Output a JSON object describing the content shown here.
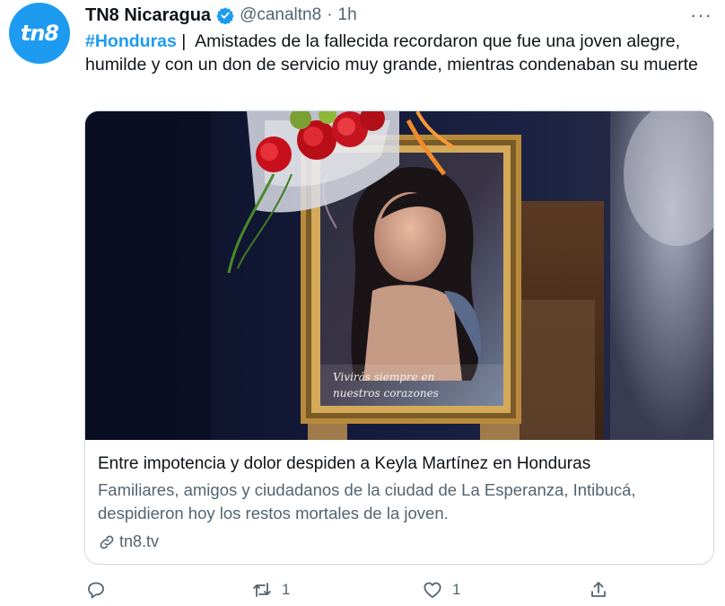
{
  "author": {
    "avatar_text": "tn8",
    "name": "TN8 Nicaragua",
    "handle": "@canaltn8",
    "separator": "·",
    "time": "1h"
  },
  "tweet": {
    "hashtag": "#Honduras",
    "pipe": " |",
    "text": "  Amistades de la fallecida recordaron que fue una joven alegre, humilde y con un don de servicio muy grande, mientras condenaban su muerte"
  },
  "card": {
    "image_caption_line1": "Vivirás siempre en",
    "image_caption_line2": "nuestros corazones",
    "title": "Entre impotencia y dolor despiden a Keyla Martínez en Honduras",
    "description": "Familiares, amigos y ciudadanos de la ciudad de La Esperanza, Intibucá, despidieron hoy los restos mortales de la joven.",
    "domain": "tn8.tv"
  },
  "actions": {
    "reply_count": "",
    "retweet_count": "1",
    "like_count": "1"
  },
  "icons": [
    "verified-badge-icon",
    "more-icon",
    "link-icon",
    "reply-icon",
    "retweet-icon",
    "like-icon",
    "share-icon"
  ],
  "colors": {
    "accent": "#1d9bf0",
    "text": "#0f1419",
    "muted": "#536471",
    "border": "#cfd9de"
  }
}
